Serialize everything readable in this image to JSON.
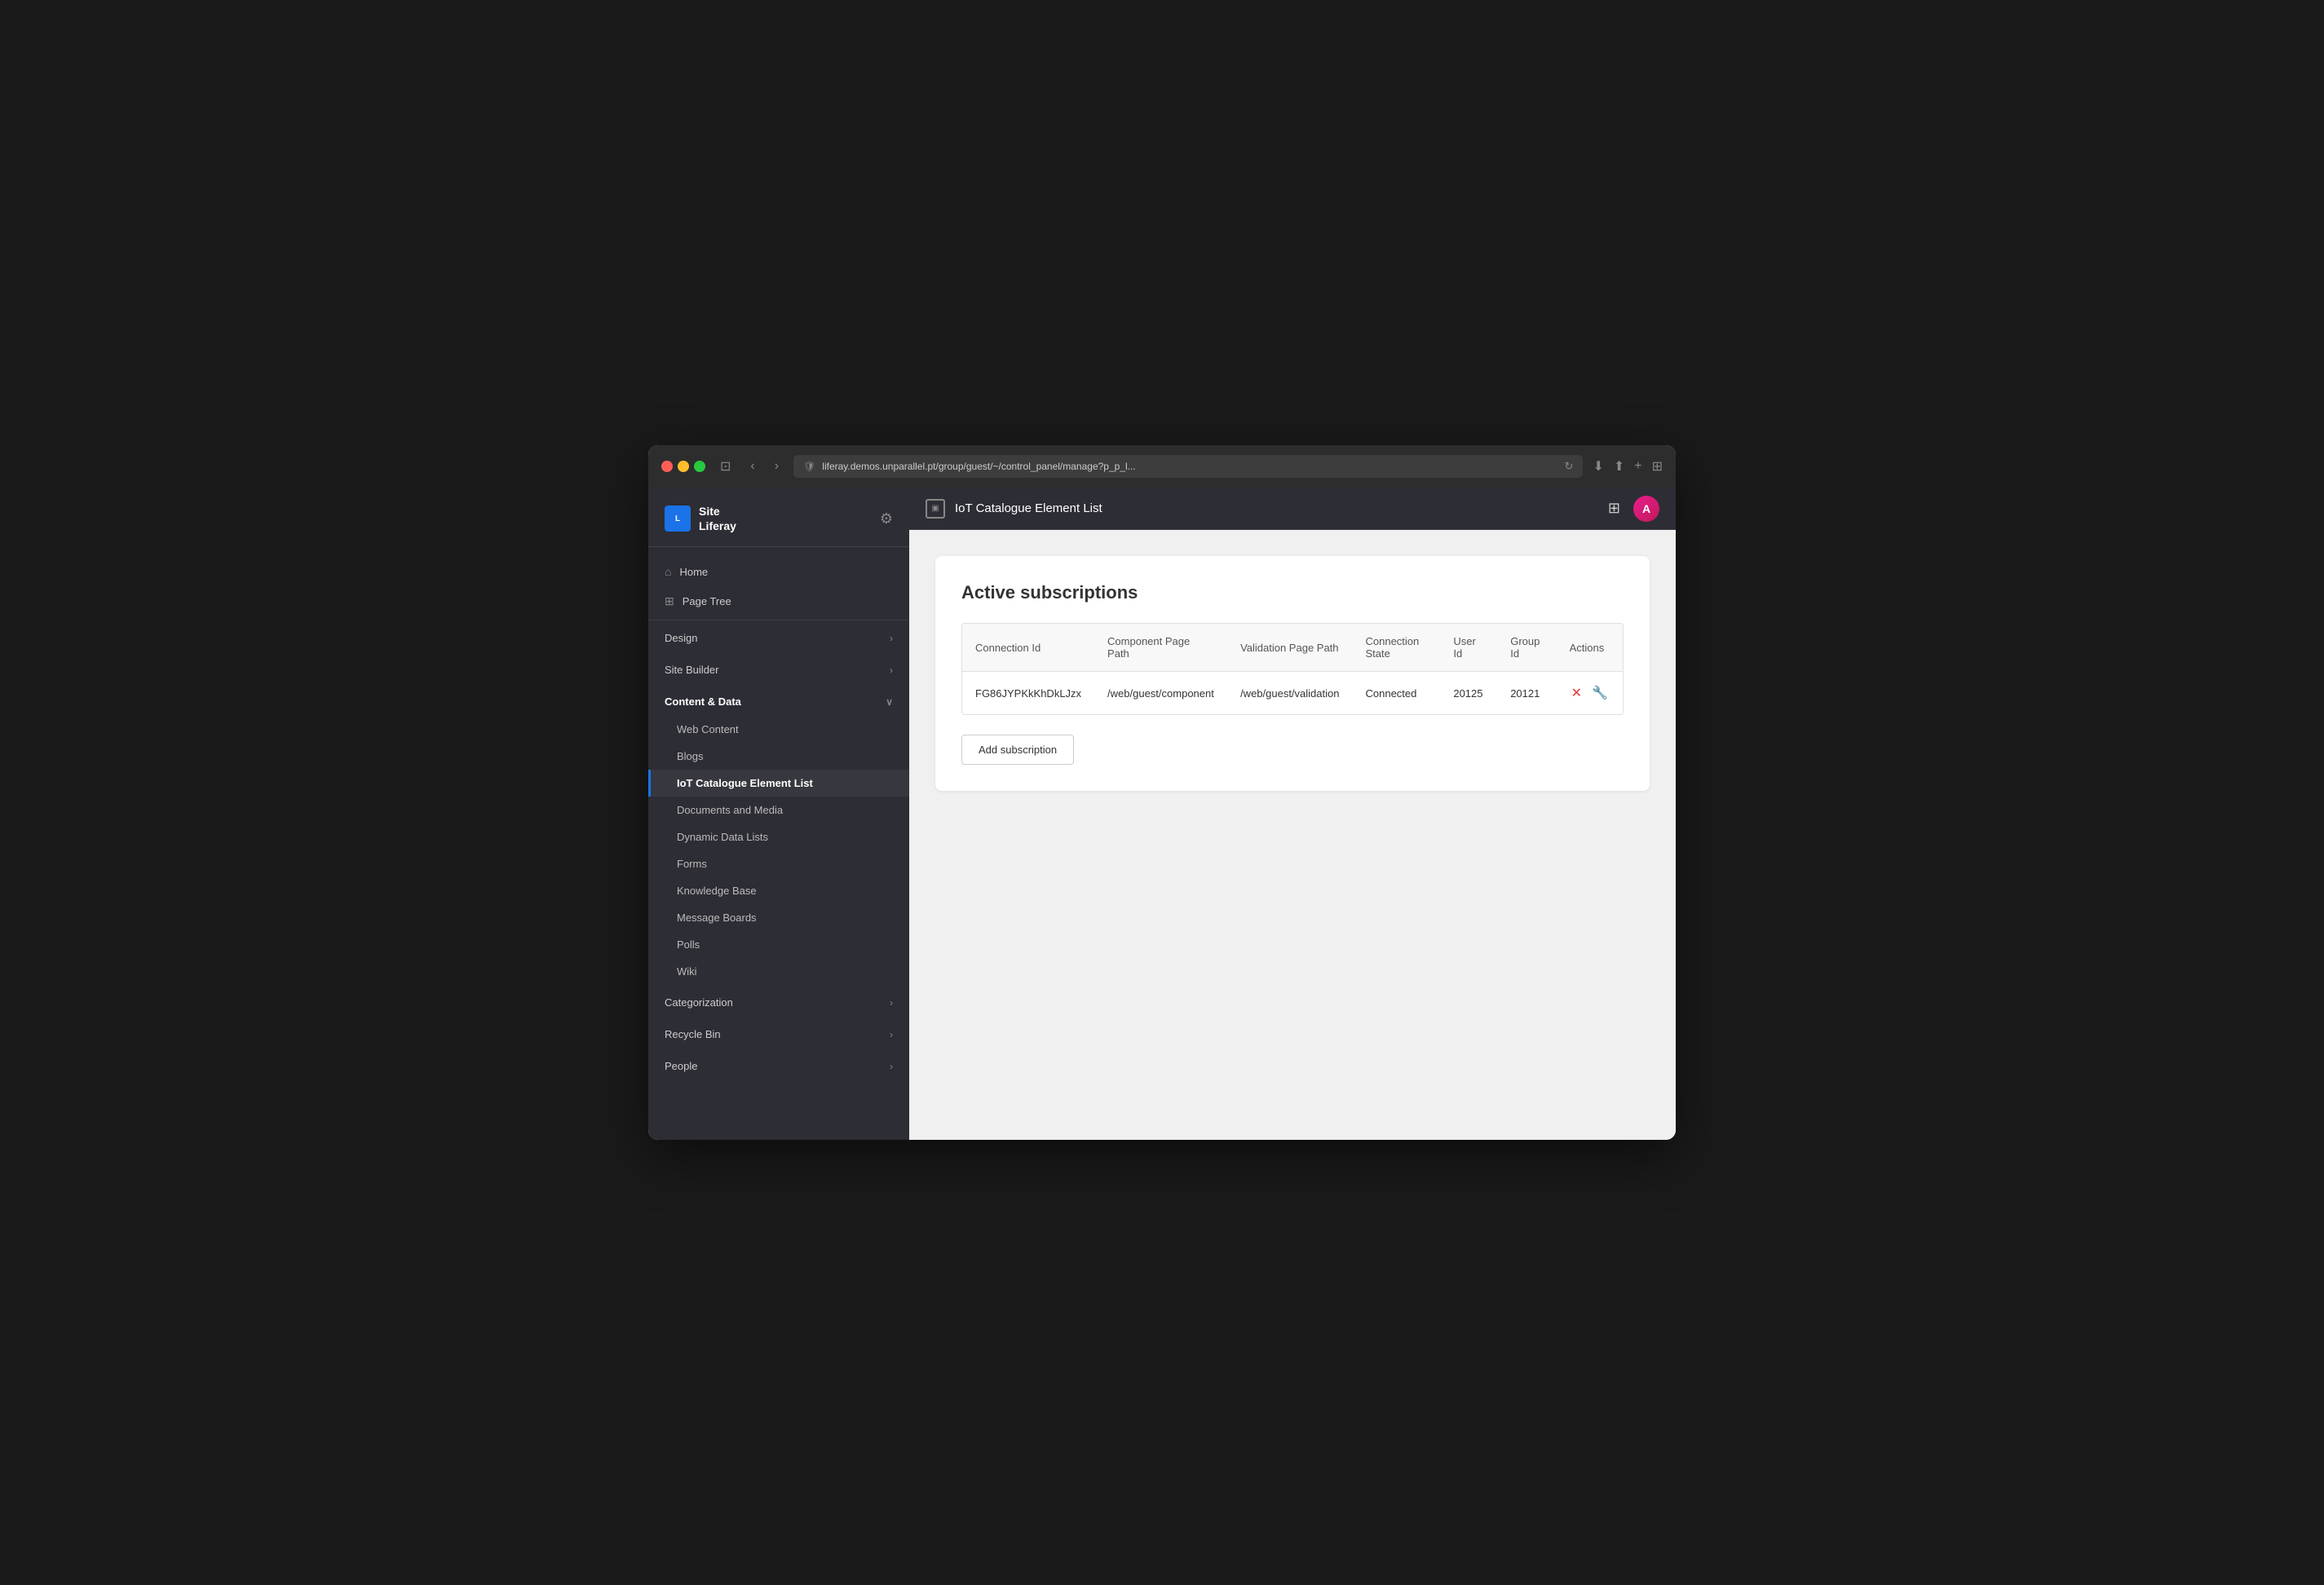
{
  "browser": {
    "url": "liferay.demos.unparallel.pt/group/guest/~/control_panel/manage?p_p_l...",
    "back_label": "‹",
    "forward_label": "›"
  },
  "topbar": {
    "title": "IoT Catalogue Element List",
    "grid_icon": "⊞",
    "avatar_initials": "A"
  },
  "sidebar": {
    "site_name_line1": "Site",
    "site_name_line2": "Liferay",
    "logo_text": "L",
    "nav_items": [
      {
        "id": "home",
        "label": "Home",
        "icon": "⌂"
      },
      {
        "id": "page-tree",
        "label": "Page Tree",
        "icon": "⊞"
      }
    ],
    "sections": [
      {
        "id": "design",
        "label": "Design",
        "expanded": false,
        "sub_items": []
      },
      {
        "id": "site-builder",
        "label": "Site Builder",
        "expanded": false,
        "sub_items": []
      },
      {
        "id": "content-data",
        "label": "Content & Data",
        "expanded": true,
        "sub_items": [
          {
            "id": "web-content",
            "label": "Web Content",
            "active": false
          },
          {
            "id": "blogs",
            "label": "Blogs",
            "active": false
          },
          {
            "id": "iot-catalogue",
            "label": "IoT Catalogue Element List",
            "active": true
          },
          {
            "id": "documents-media",
            "label": "Documents and Media",
            "active": false
          },
          {
            "id": "dynamic-data-lists",
            "label": "Dynamic Data Lists",
            "active": false
          },
          {
            "id": "forms",
            "label": "Forms",
            "active": false
          },
          {
            "id": "knowledge-base",
            "label": "Knowledge Base",
            "active": false
          },
          {
            "id": "message-boards",
            "label": "Message Boards",
            "active": false
          },
          {
            "id": "polls",
            "label": "Polls",
            "active": false
          },
          {
            "id": "wiki",
            "label": "Wiki",
            "active": false
          }
        ]
      },
      {
        "id": "categorization",
        "label": "Categorization",
        "expanded": false,
        "sub_items": []
      },
      {
        "id": "recycle-bin",
        "label": "Recycle Bin",
        "expanded": false,
        "sub_items": []
      },
      {
        "id": "people",
        "label": "People",
        "expanded": false,
        "sub_items": []
      }
    ]
  },
  "content": {
    "panel_title": "Active subscriptions",
    "table": {
      "columns": [
        {
          "id": "connection-id",
          "label": "Connection Id"
        },
        {
          "id": "component-page-path",
          "label": "Component Page Path"
        },
        {
          "id": "validation-page-path",
          "label": "Validation Page Path"
        },
        {
          "id": "connection-state",
          "label": "Connection State"
        },
        {
          "id": "user-id",
          "label": "User Id"
        },
        {
          "id": "group-id",
          "label": "Group Id"
        },
        {
          "id": "actions",
          "label": "Actions"
        }
      ],
      "rows": [
        {
          "connection_id": "FG86JYPKkKhDkLJzx",
          "component_page_path": "/web/guest/component",
          "validation_page_path": "/web/guest/validation",
          "connection_state": "Connected",
          "user_id": "20125",
          "group_id": "20121"
        }
      ]
    },
    "add_subscription_label": "Add subscription"
  }
}
